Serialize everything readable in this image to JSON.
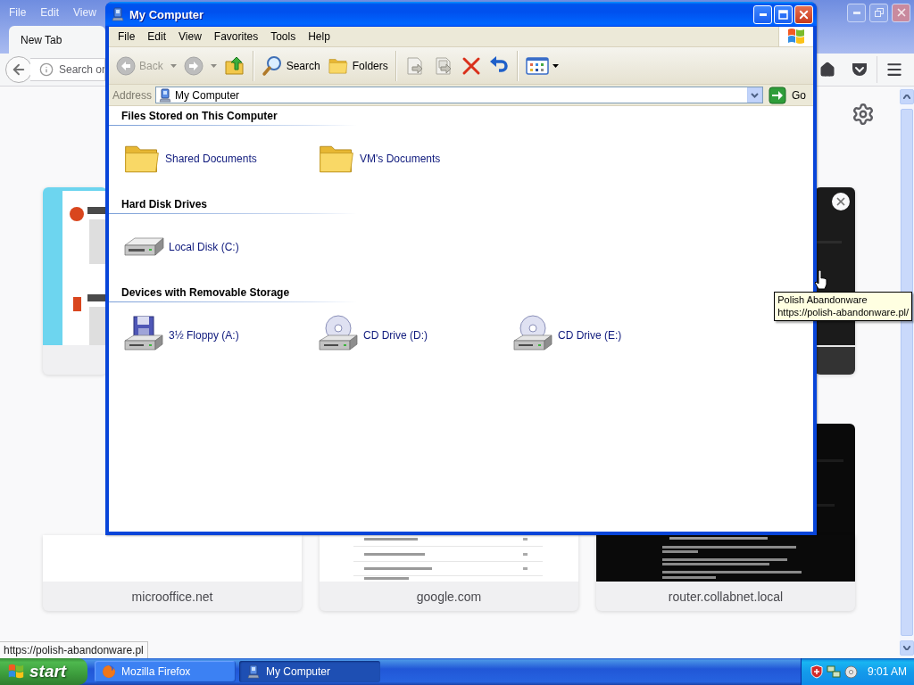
{
  "browser": {
    "menu": [
      "File",
      "Edit",
      "View"
    ],
    "tabs": [
      {
        "label": "New Tab",
        "selected": true
      }
    ],
    "search": {
      "placeholder": "Search or"
    },
    "tiles": [
      {
        "label": "microoffice.net"
      },
      {
        "label": "google.com"
      },
      {
        "label": "router.collabnet.local"
      }
    ],
    "status_text": "https://polish-abandonware.pl"
  },
  "explorer": {
    "title": "My Computer",
    "menu": [
      "File",
      "Edit",
      "View",
      "Favorites",
      "Tools",
      "Help"
    ],
    "toolbar": {
      "back": {
        "label": "Back",
        "disabled": true
      },
      "forward": {
        "disabled": true
      },
      "search": {
        "label": "Search"
      },
      "folders": {
        "label": "Folders"
      }
    },
    "address": {
      "label": "Address",
      "value": "My Computer",
      "go": "Go"
    },
    "groups": [
      {
        "title": "Files Stored on This Computer",
        "items": [
          {
            "label": "Shared Documents",
            "kind": "folder"
          },
          {
            "label": "VM's Documents",
            "kind": "folder"
          }
        ]
      },
      {
        "title": "Hard Disk Drives",
        "items": [
          {
            "label": "Local Disk (C:)",
            "kind": "harddisk"
          }
        ]
      },
      {
        "title": "Devices with Removable Storage",
        "items": [
          {
            "label": "3½ Floppy (A:)",
            "kind": "floppy"
          },
          {
            "label": "CD Drive (D:)",
            "kind": "cd"
          },
          {
            "label": "CD Drive (E:)",
            "kind": "cd"
          }
        ]
      }
    ]
  },
  "tooltip": {
    "title": "Polish Abandonware",
    "url": "https://polish-abandonware.pl/"
  },
  "taskbar": {
    "start": "start",
    "tasks": [
      {
        "label": "Mozilla Firefox",
        "selected": false,
        "kind": "firefox"
      },
      {
        "label": "My Computer",
        "selected": true,
        "kind": "computer"
      }
    ],
    "clock": "9:01 AM"
  }
}
